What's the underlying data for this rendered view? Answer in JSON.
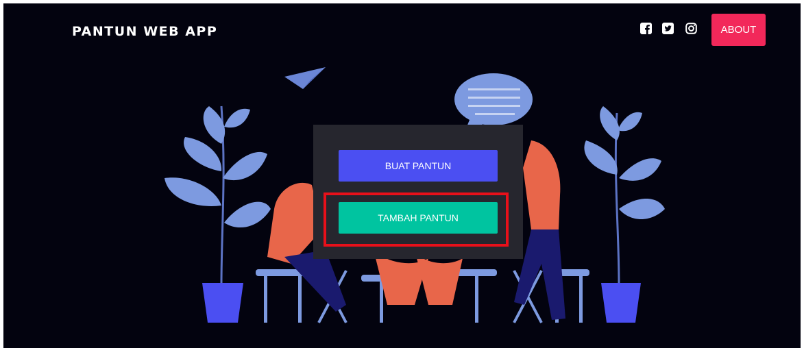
{
  "navbar": {
    "brand": "PANTUN WEB APP",
    "social_icons": [
      "facebook-icon",
      "twitter-icon",
      "instagram-icon"
    ],
    "about_label": "ABOUT"
  },
  "menu": {
    "buat_label": "BUAT PANTUN",
    "tambah_label": "TAMBAH PANTUN"
  },
  "colors": {
    "background": "#03030f",
    "about_button": "#f2285a",
    "buat_button": "#4b4ff2",
    "tambah_button": "#00c4a0",
    "panel": "#26262e",
    "highlight": "#e8101a"
  }
}
